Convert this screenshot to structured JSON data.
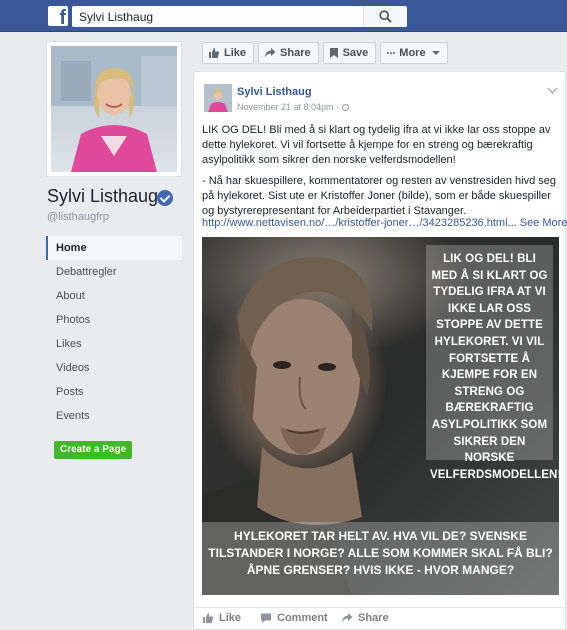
{
  "header": {
    "logo_letter": "f",
    "search_value": "Sylvi Listhaug",
    "brand_color": "#3b5998"
  },
  "profile": {
    "name": "Sylvi Listhaug",
    "handle": "@listhaugfrp"
  },
  "nav": {
    "items": [
      "Home",
      "Debattregler",
      "About",
      "Photos",
      "Likes",
      "Videos",
      "Posts",
      "Events"
    ],
    "active": "Home"
  },
  "create_page_label": "Create a Page",
  "page_actions": {
    "like": "Like",
    "share": "Share",
    "save": "Save",
    "more": "More"
  },
  "post": {
    "author": "Sylvi Listhaug",
    "timestamp": "November 21 at 8:04pm · ",
    "paragraph1": "LIK OG DEL! Bli med å si klart og tydelig ifra at vi ikke lar oss stoppe av dette hylekoret. Vi vil fortsette å kjempe for en streng og bærekraftig asylpolitikk som sikrer den norske velferdsmodellen!",
    "paragraph2": "- Nå har skuespillere, kommentatorer og resten av venstresiden hivd seg på hylekoret. Sist ute er Kristoffer Joner (bilde), som er både skuespiller og bystyrerepresentant for Arbeiderpartiet i Stavanger.",
    "link_text": "http://www.nettavisen.no/…/kristoffer-joner…/3423285236.html",
    "link_sep": "...",
    "see_more": "See More",
    "image_overlay_right": "LIK OG DEL! BLI MED Å SI KLART OG TYDELIG IFRA AT VI IKKE LAR OSS STOPPE AV DETTE HYLEKORET. VI VIL FORTSETTE Å KJEMPE FOR EN STRENG OG BÆREKRAFTIG ASYLPOLITIKK SOM SIKRER DEN NORSKE VELFERDSMODELLEN!",
    "image_overlay_bottom": "HYLEKORET TAR HELT AV. HVA VIL DE? SVENSKE TILSTANDER I NORGE? ALLE SOM KOMMER SKAL FÅ BLI? ÅPNE GRENSER? HVIS IKKE - HVOR MANGE?",
    "footer": {
      "like": "Like",
      "comment": "Comment",
      "share": "Share"
    }
  }
}
